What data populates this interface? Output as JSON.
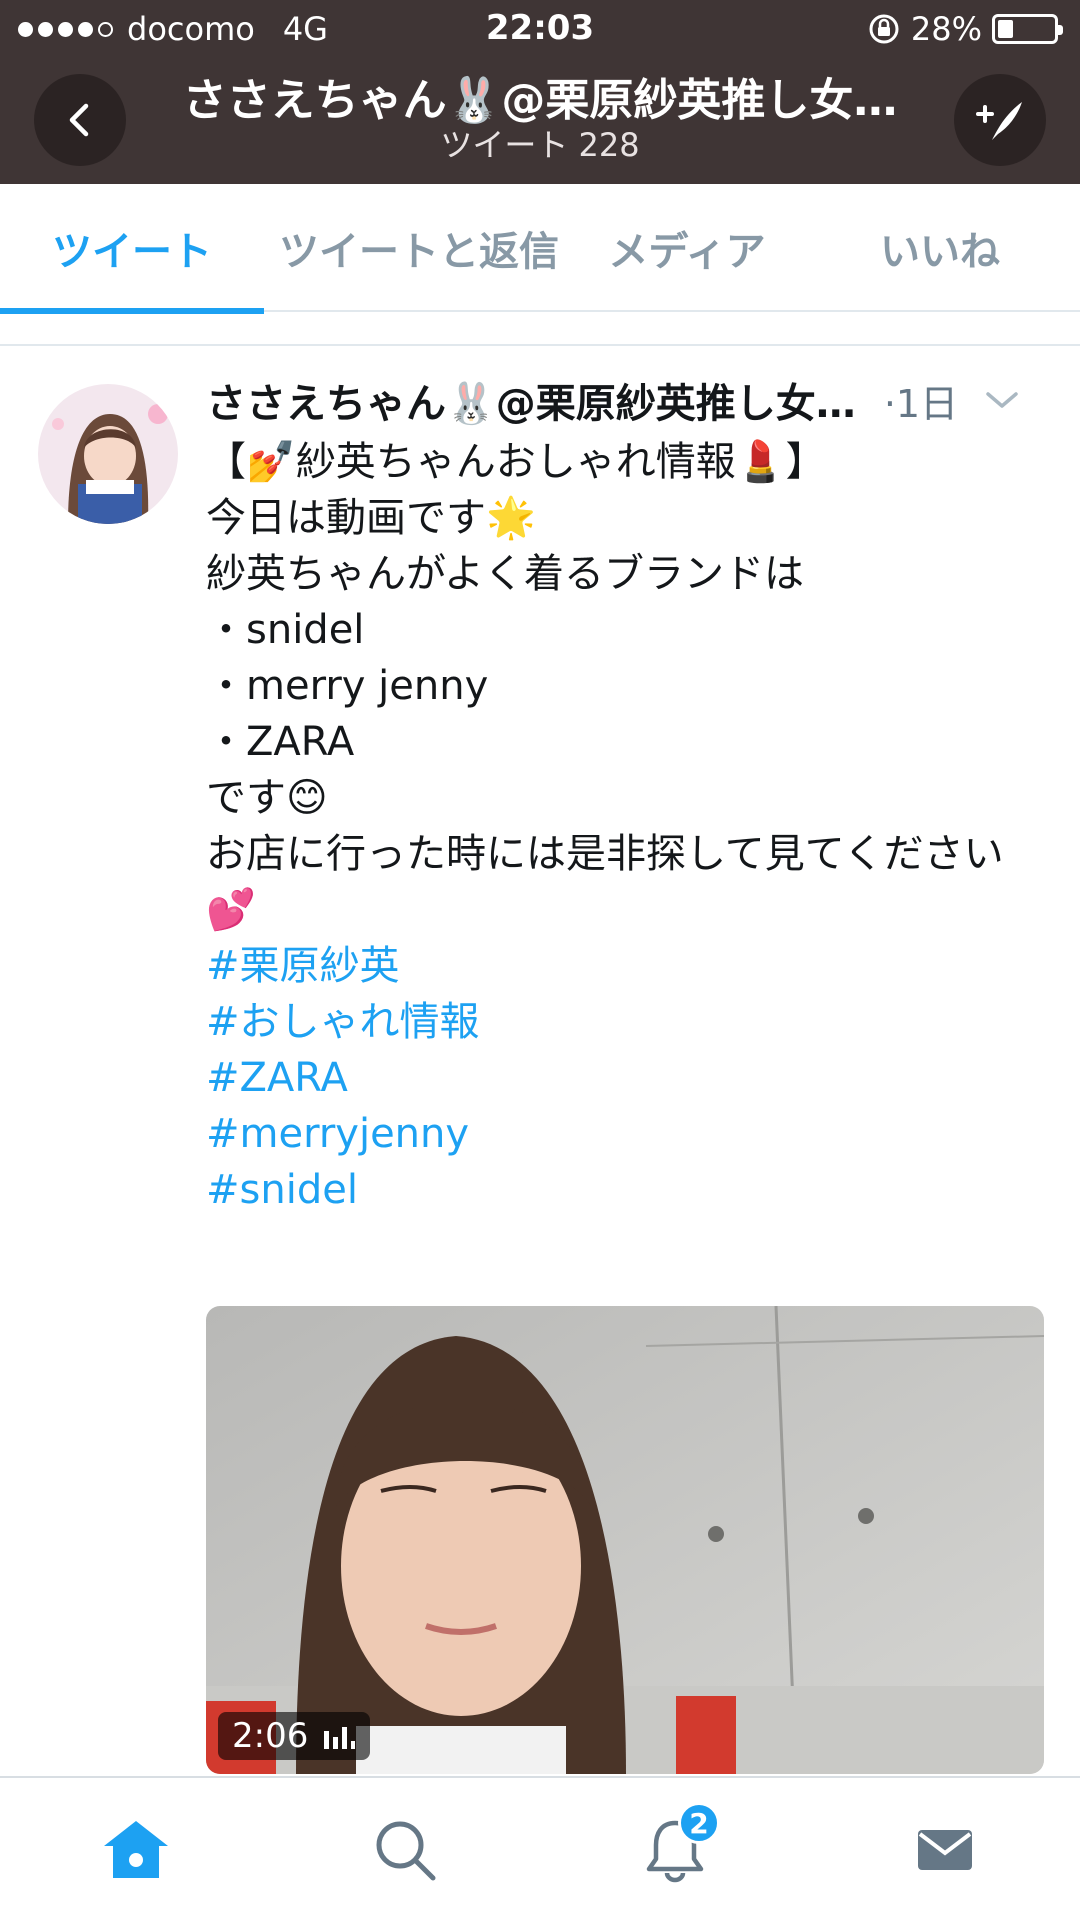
{
  "status_bar": {
    "carrier": "docomo",
    "network": "4G",
    "time": "22:03",
    "battery_percent": "28%",
    "battery_level": 0.28
  },
  "header": {
    "title": "ささえちゃん🐰@栗原紗英推し女…",
    "subtitle": "ツイート 228",
    "back_icon": "chevron-left-icon",
    "compose_icon": "compose-quill-icon"
  },
  "tabs": [
    {
      "label": "ツイート",
      "active": true
    },
    {
      "label": "ツイートと返信",
      "active": false
    },
    {
      "label": "メディア",
      "active": false
    },
    {
      "label": "いいね",
      "active": false
    }
  ],
  "tweet": {
    "author": "ささえちゃん🐰@栗原紗英推し女…",
    "time": "·1日",
    "lines": [
      "【💅紗英ちゃんおしゃれ情報💄】",
      "今日は動画です🌟",
      "紗英ちゃんがよく着るブランドは",
      "・snidel",
      "・merry jenny",
      "・ZARA",
      "です😊",
      "お店に行った時には是非探して見てください💕"
    ],
    "hashtags": [
      "#栗原紗英",
      "#おしゃれ情報",
      "#ZARA",
      "#merryjenny",
      "#snidel"
    ],
    "video_duration": "2:06"
  },
  "bottom_nav": {
    "items": [
      "home-icon",
      "search-icon",
      "notifications-icon",
      "messages-icon"
    ],
    "notification_count": "2"
  },
  "colors": {
    "header_bg": "#3f3535",
    "accent": "#1da1f2",
    "muted": "#8899a6"
  }
}
